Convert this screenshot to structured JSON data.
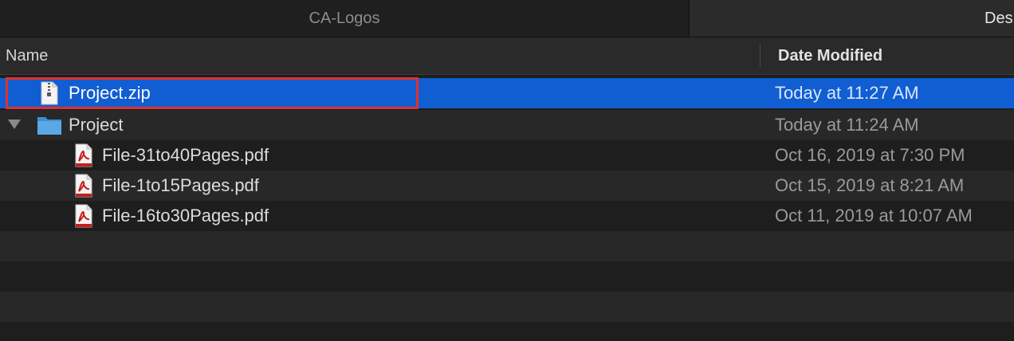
{
  "tabs": [
    {
      "label": "CA-Logos"
    },
    {
      "label": "Des"
    }
  ],
  "columns": {
    "name": "Name",
    "date_modified": "Date Modified"
  },
  "files": [
    {
      "name": "Project.zip",
      "date": "Today at 11:27 AM",
      "icon": "zip-file-icon",
      "selected": true
    },
    {
      "name": "Project",
      "date": "Today at 11:24 AM",
      "icon": "folder-icon",
      "expanded": true
    },
    {
      "name": "File-31to40Pages.pdf",
      "date": "Oct 16, 2019 at 7:30 PM",
      "icon": "pdf-file-icon"
    },
    {
      "name": "File-1to15Pages.pdf",
      "date": "Oct 15, 2019 at 8:21 AM",
      "icon": "pdf-file-icon"
    },
    {
      "name": "File-16to30Pages.pdf",
      "date": "Oct 11, 2019 at 10:07 AM",
      "icon": "pdf-file-icon"
    }
  ],
  "colors": {
    "selection": "#105ed1",
    "highlight_border": "#e0302e",
    "folder": "#5aa9e6",
    "pdf_red": "#c61e1e"
  }
}
